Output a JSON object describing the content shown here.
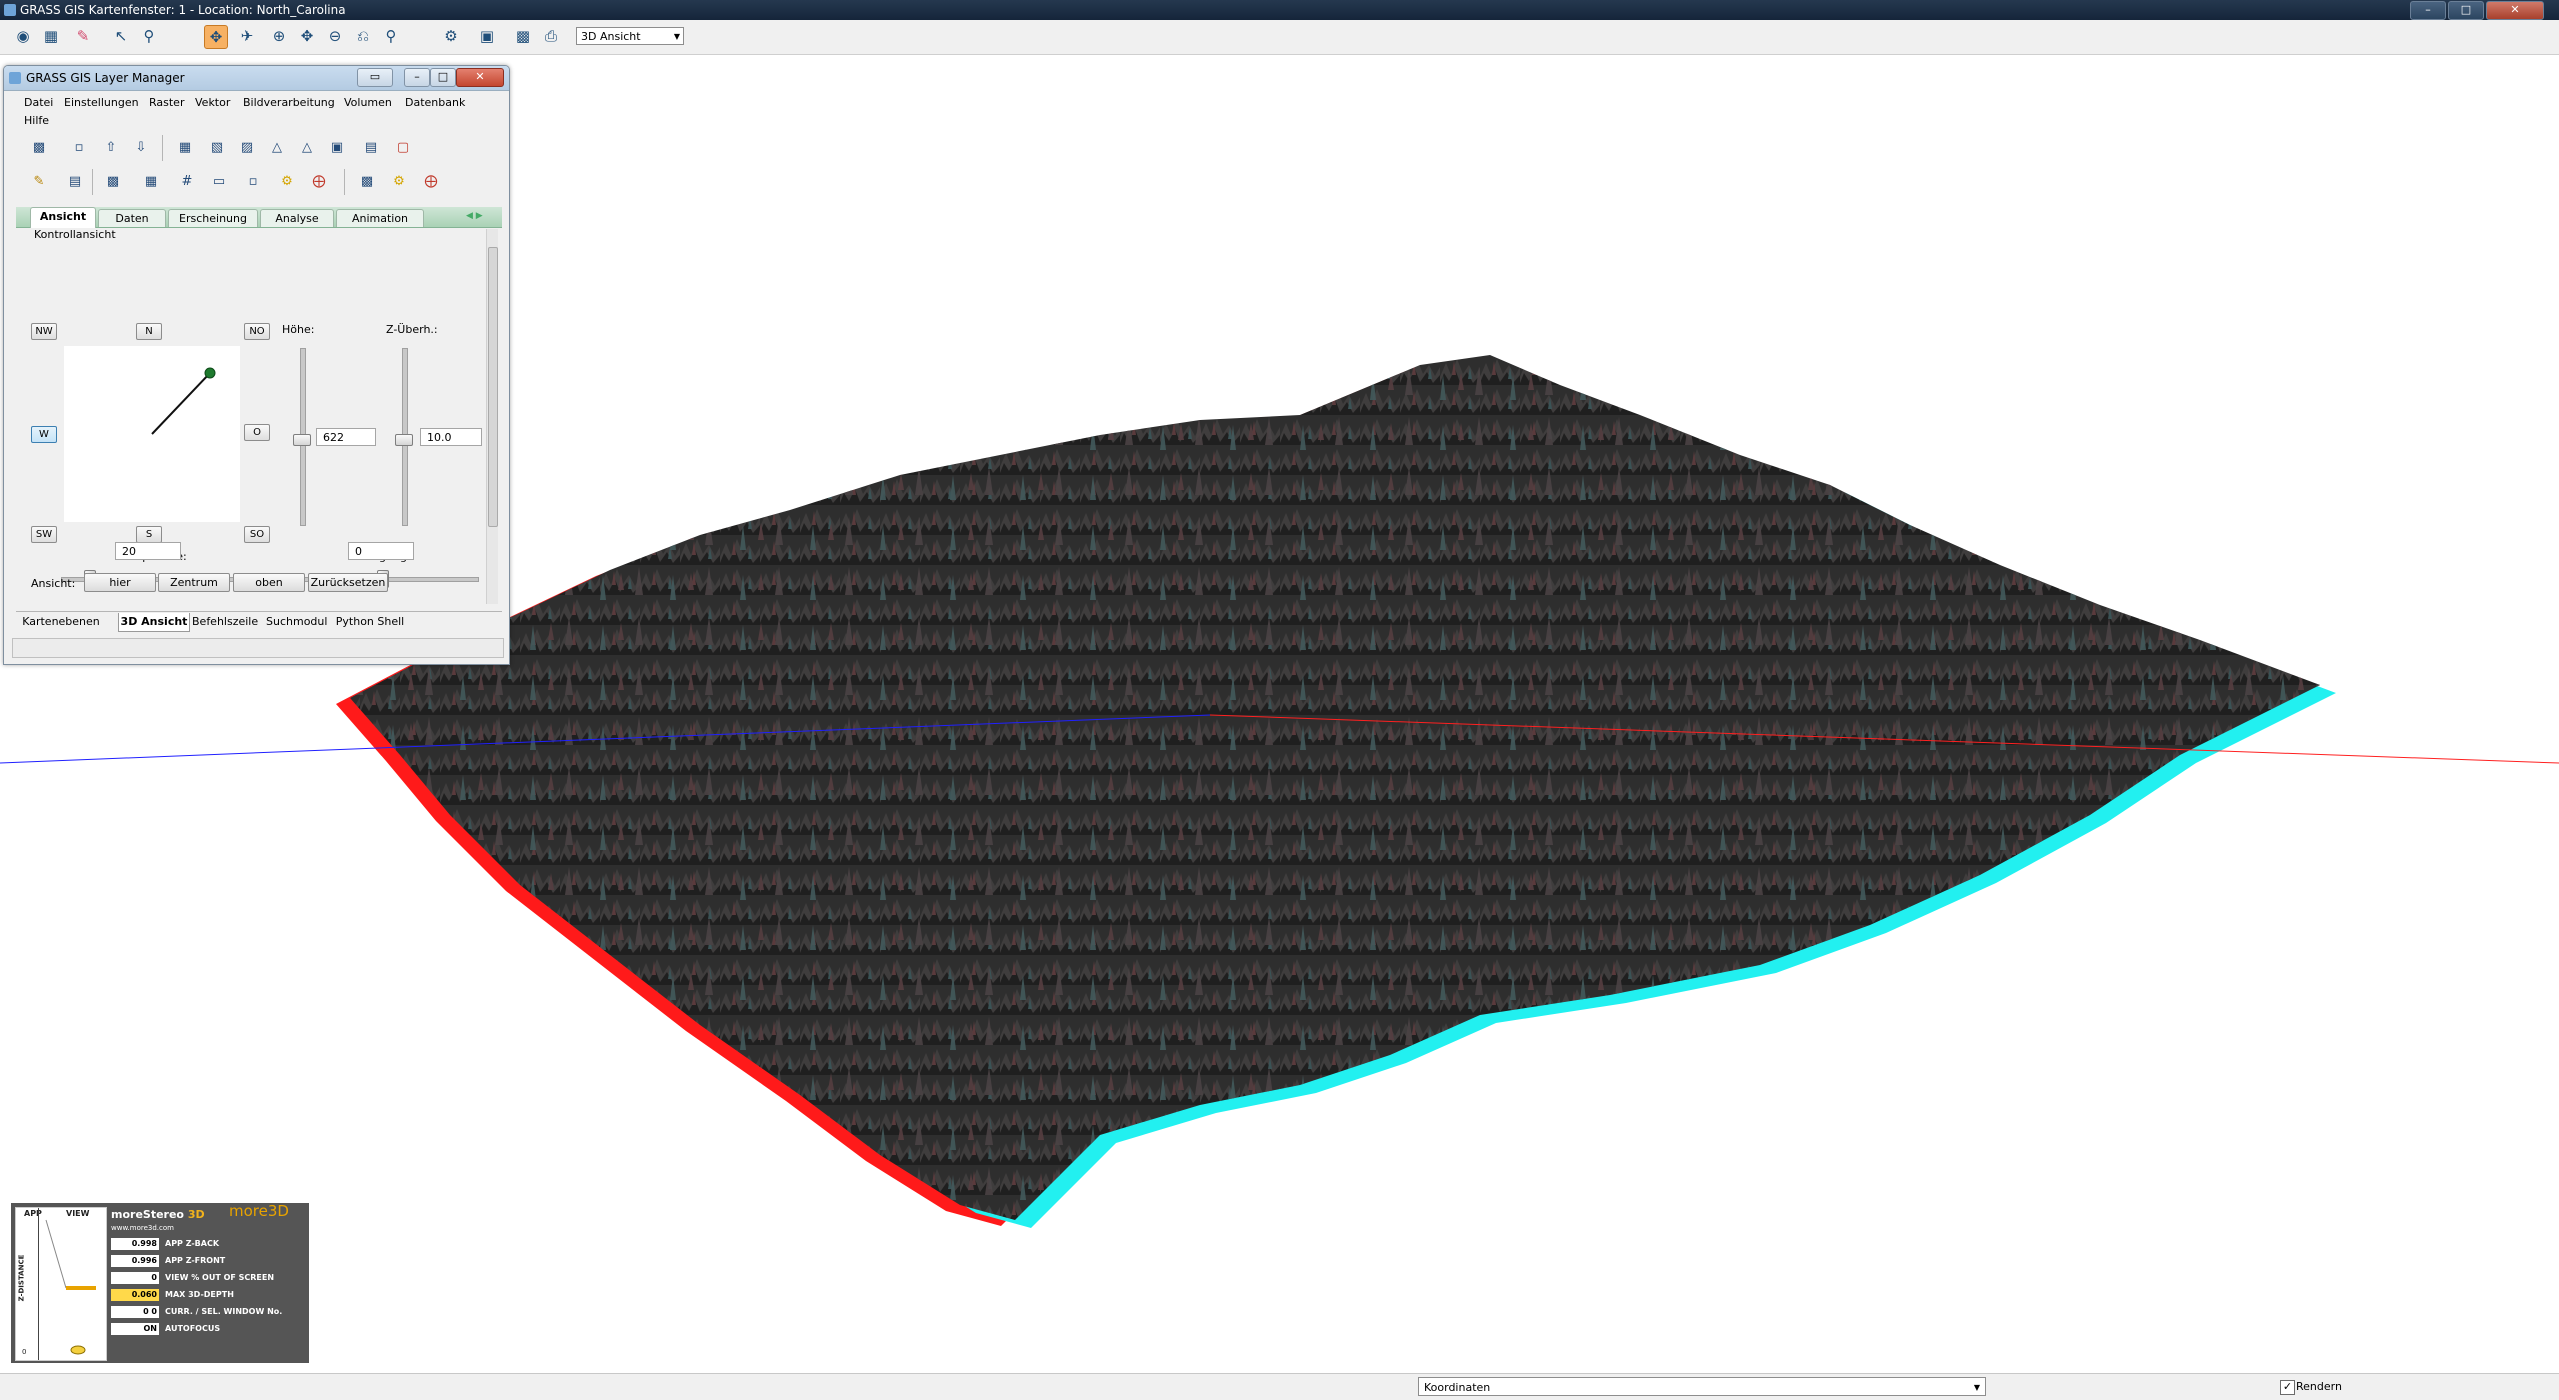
{
  "window": {
    "title": "GRASS GIS Kartenfenster: 1  - Location: North_Carolina",
    "buttons": [
      "–",
      "□",
      "✕"
    ]
  },
  "toolbar": {
    "icons": [
      "eye-icon",
      "add-layer-icon",
      "erase-icon",
      "pointer-icon",
      "query-icon",
      "rotate-3d-icon",
      "fly-icon",
      "zoom-in-icon",
      "pan-icon",
      "zoom-out-icon",
      "zoom-back-icon",
      "zoom-menu-icon",
      "decoration-icon",
      "save-icon",
      "print-icon"
    ],
    "view_mode": "3D Ansicht"
  },
  "status": {
    "mode": "Koordinaten",
    "render_label": "Rendern",
    "render_checked": true
  },
  "layer_manager": {
    "title": "GRASS GIS Layer Manager",
    "menu_row1": [
      "Datei",
      "Einstellungen",
      "Raster",
      "Vektor",
      "Bildverarbeitung",
      "Volumen",
      "Datenbank"
    ],
    "menu_row2": [
      "Hilfe"
    ],
    "tabs": [
      "Ansicht",
      "Daten",
      "Erscheinung",
      "Analyse",
      "Animation"
    ],
    "active_tab": "Ansicht",
    "section": "Kontrollansicht",
    "directions": {
      "nw": "NW",
      "n": "N",
      "no": "NO",
      "w": "W",
      "o": "O",
      "sw": "SW",
      "s": "S",
      "so": "SO"
    },
    "hoehe": {
      "label": "Höhe:",
      "value": "622"
    },
    "z_ueberh": {
      "label": "Z-Überh.:",
      "value": "10.0"
    },
    "perspektive": {
      "label": "Perspektive:",
      "value": "20"
    },
    "neigung": {
      "label": "Neigung:",
      "value": "0"
    },
    "ansicht": {
      "label": "Ansicht:",
      "buttons": [
        "hier",
        "Zentrum",
        "oben",
        "Zurücksetzen"
      ]
    },
    "bottom_tabs": [
      "Kartenebenen",
      "3D Ansicht",
      "Befehlszeile",
      "Suchmodul",
      "Python Shell"
    ],
    "active_bottom_tab": "3D Ansicht"
  },
  "morestereo": {
    "app_label": "APP",
    "view_label": "VIEW",
    "axis_label": "Z-DISTANCE",
    "axis_zero": "0",
    "brand": "moreStereo",
    "brand_3d": "3D",
    "url": "www.more3d.com",
    "logo": "more3D",
    "rows": [
      {
        "value": "0.998",
        "label": "APP Z-BACK",
        "highlight": false
      },
      {
        "value": "0.996",
        "label": "APP Z-FRONT",
        "highlight": false
      },
      {
        "value": "0",
        "label": "VIEW % OUT OF SCREEN",
        "highlight": false
      },
      {
        "value": "0.060",
        "label": "MAX 3D-DEPTH",
        "highlight": true
      },
      {
        "value": "0     0",
        "label": "CURR. / SEL. WINDOW No.",
        "highlight": false
      },
      {
        "value": "ON",
        "label": "AUTOFOCUS",
        "highlight": false
      }
    ]
  },
  "colors": {
    "terrain": "#2b2b2b",
    "anaglyph_red": "#ff1a1a",
    "anaglyph_cyan": "#22f0f0",
    "axis_red": "#ff2020",
    "axis_blue": "#2020ff",
    "tab_green": "#a9d2b5"
  }
}
